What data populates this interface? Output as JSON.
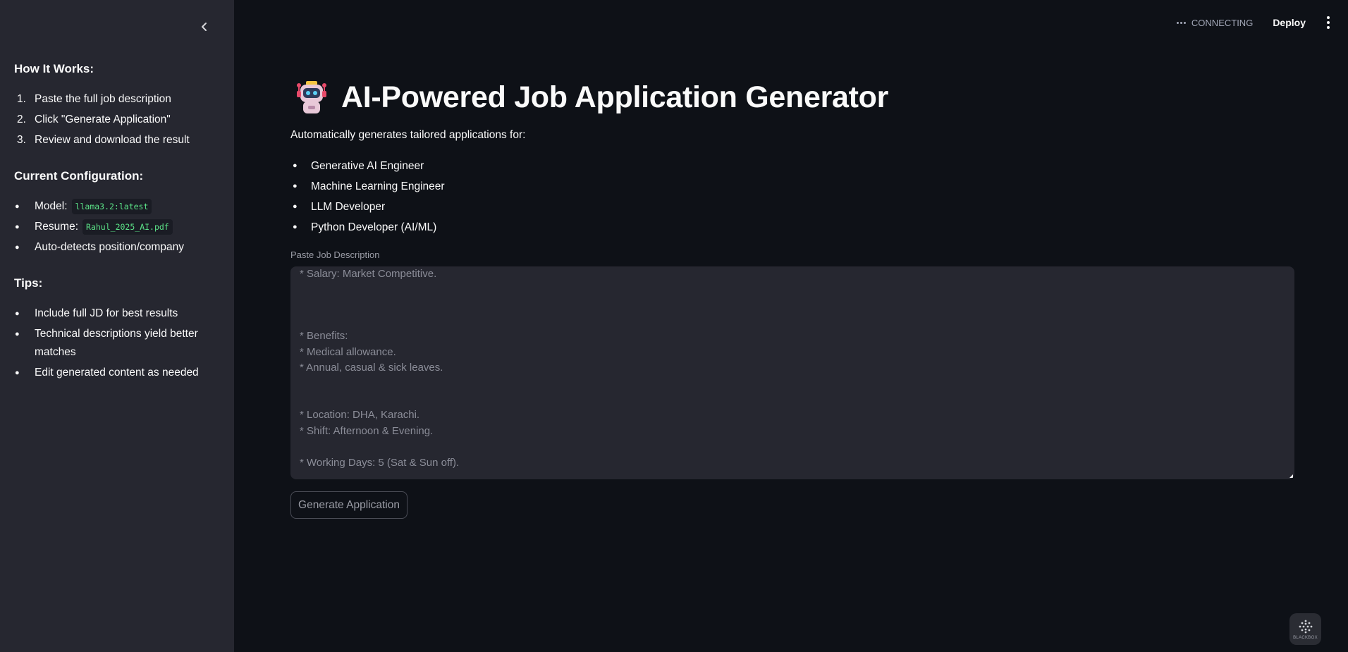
{
  "sidebar": {
    "how_title": "How It Works:",
    "steps": [
      {
        "num": "1.",
        "text": "Paste the full job description"
      },
      {
        "num": "2.",
        "text": "Click \"Generate Application\""
      },
      {
        "num": "3.",
        "text": "Review and download the result"
      }
    ],
    "config_title": "Current Configuration:",
    "config": {
      "model_label": "Model:",
      "model_value": "llama3.2:latest",
      "resume_label": "Resume:",
      "resume_value": "Rahul_2025_AI.pdf",
      "auto_detect": "Auto-detects position/company"
    },
    "tips_title": "Tips:",
    "tips": [
      "Include full JD for best results",
      "Technical descriptions yield better matches",
      "Edit generated content as needed"
    ]
  },
  "topbar": {
    "status": "CONNECTING",
    "deploy_label": "Deploy"
  },
  "main": {
    "title": "AI-Powered Job Application Generator",
    "subtitle": "Automatically generates tailored applications for:",
    "roles": [
      "Generative AI Engineer",
      "Machine Learning Engineer",
      "LLM Developer",
      "Python Developer (AI/ML)"
    ],
    "input_label": "Paste Job Description",
    "jd_lines": {
      "salary": "* Salary: Market Competitive.",
      "benefits": "* Benefits:",
      "medical": "* Medical allowance.",
      "leaves": "* Annual, casual & sick leaves.",
      "location": "* Location: DHA, Karachi.",
      "shift": "* Shift: Afternoon & Evening.",
      "working_days": "* Working Days: 5 (Sat & Sun off)."
    },
    "generate_label": "Generate Application"
  },
  "badge": {
    "text": "BLACKBOX"
  },
  "colors": {
    "background": "#0e1117",
    "sidebar": "#262730",
    "code_text": "#5ce488",
    "text": "#fafafa"
  },
  "icons": {
    "collapse": "chevron-left-icon",
    "status": "ellipsis-icon",
    "menu": "kebab-menu-icon",
    "title": "robot-icon",
    "badge": "blackbox-logo-icon"
  }
}
